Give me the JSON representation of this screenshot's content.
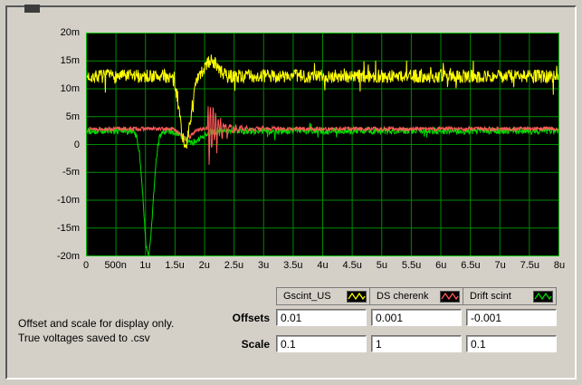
{
  "controls": {
    "offsets_label": "Offsets",
    "scale_label": "Scale",
    "offsets": [
      "0.01",
      "0.001",
      "-0.001"
    ],
    "scales": [
      "0.1",
      "1",
      "0.1"
    ]
  },
  "notes": {
    "line1": "Offset and scale for display only.",
    "line2": "True voltages saved to .csv"
  },
  "chart_data": {
    "type": "line",
    "title": "",
    "xlabel": "",
    "ylabel": "",
    "x_ticks": [
      "0",
      "500n",
      "1u",
      "1.5u",
      "2u",
      "2.5u",
      "3u",
      "3.5u",
      "4u",
      "4.5u",
      "5u",
      "5.5u",
      "6u",
      "6.5u",
      "7u",
      "7.5u",
      "8u"
    ],
    "y_ticks": [
      "20m",
      "15m",
      "10m",
      "5m",
      "0",
      "-5m",
      "-10m",
      "-15m",
      "-20m"
    ],
    "x_range": [
      0,
      8e-06
    ],
    "y_range": [
      -0.02,
      0.02
    ],
    "grid": true,
    "bg_color": "#000000",
    "grid_color": "#008a00",
    "frame_color": "#00c000",
    "legend_position": "bottom",
    "series": [
      {
        "name": "Gscint_US",
        "color": "#ffff00",
        "seed": 7,
        "baseline": 0.0122,
        "noise": 0.0012,
        "spike_p": 0.05,
        "spike_amp": 0.0024,
        "features": [
          {
            "type": "gauss",
            "center": 1.68e-06,
            "sigma": 9e-08,
            "amp": -0.0122
          },
          {
            "type": "gauss",
            "center": 2.12e-06,
            "sigma": 1e-07,
            "amp": 0.0028
          }
        ]
      },
      {
        "name": "DS cherenk",
        "color": "#ff5a5a",
        "seed": 13,
        "baseline": 0.0028,
        "noise": 0.00035,
        "spike_p": 0.0,
        "spike_amp": 0,
        "features": [
          {
            "type": "gauss",
            "center": 1.7e-06,
            "sigma": 9e-08,
            "amp": -0.0018
          },
          {
            "type": "ring",
            "start": 2.05e-06,
            "amp": 0.0075,
            "tau": 1.3e-07,
            "freq": 23000000.0
          },
          {
            "type": "ring",
            "start": 2.05e-06,
            "amp": 0.0015,
            "tau": 4.5e-07,
            "freq": 11000000.0
          }
        ]
      },
      {
        "name": "Drift scint",
        "color": "#00dc00",
        "seed": 29,
        "baseline": 0.0024,
        "noise": 0.0006,
        "spike_p": 0.03,
        "spike_amp": 0.0012,
        "features": [
          {
            "type": "gauss",
            "center": 1.05e-06,
            "sigma": 8e-08,
            "amp": -0.0222
          },
          {
            "type": "gauss",
            "center": 1.8e-06,
            "sigma": 1.5e-07,
            "amp": -0.002
          }
        ]
      }
    ]
  }
}
